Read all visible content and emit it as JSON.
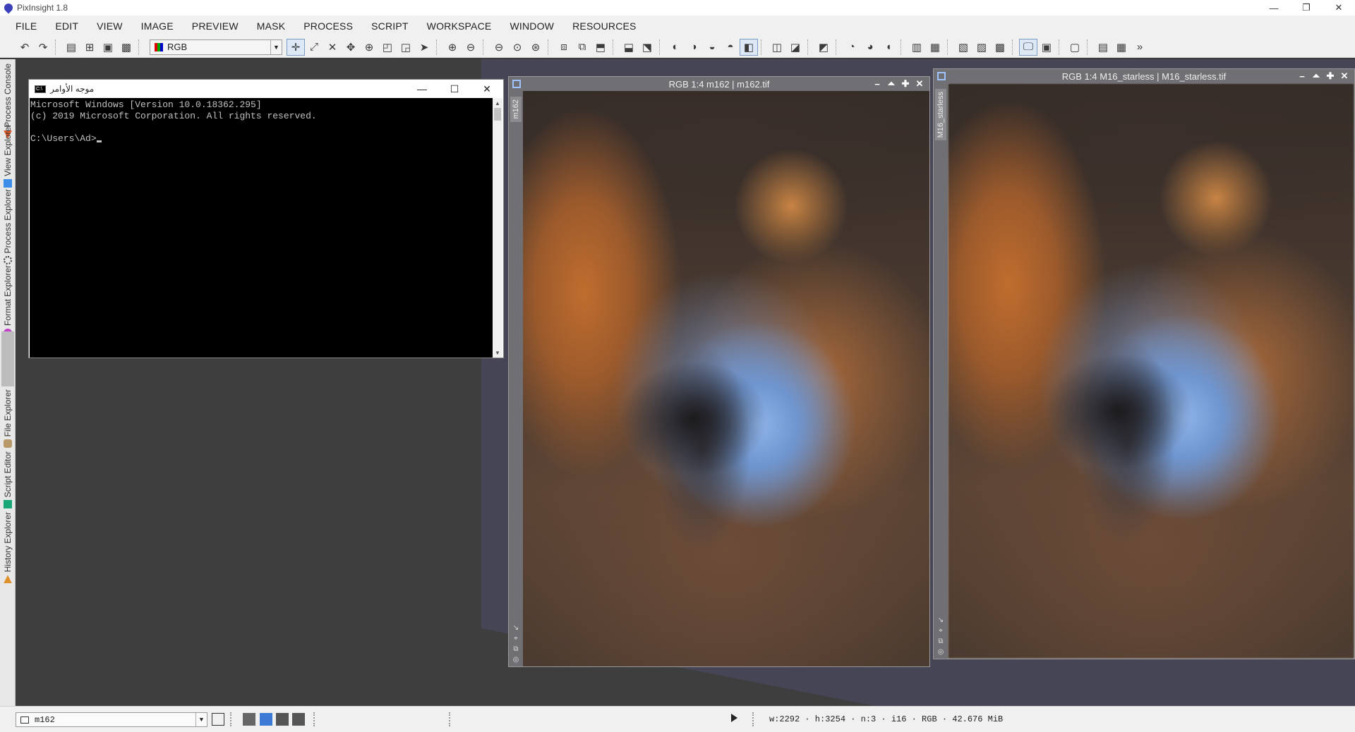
{
  "app": {
    "title": "PixInsight 1.8"
  },
  "window_controls": {
    "minimize": "—",
    "restore": "❐",
    "close": "✕"
  },
  "menu": [
    "FILE",
    "EDIT",
    "VIEW",
    "IMAGE",
    "PREVIEW",
    "MASK",
    "PROCESS",
    "SCRIPT",
    "WORKSPACE",
    "WINDOW",
    "RESOURCES"
  ],
  "toolbar": {
    "color_space": "RGB",
    "overflow": "»"
  },
  "side_panel": {
    "tabs": [
      {
        "label": "Process Console",
        "icon": "process-console-icon",
        "color": "#e0592a"
      },
      {
        "label": "View Explorer",
        "icon": "view-explorer-icon",
        "color": "#3d8ee8"
      },
      {
        "label": "Process Explorer",
        "icon": "gear-icon",
        "color": "#444444"
      },
      {
        "label": "Format Explorer",
        "icon": "format-explorer-icon",
        "color": "#c040c8"
      },
      {
        "label": "File Explorer",
        "icon": "file-explorer-icon",
        "color": "#b89a6a"
      },
      {
        "label": "Script Editor",
        "icon": "script-editor-icon",
        "color": "#18a878"
      },
      {
        "label": "History Explorer",
        "icon": "history-explorer-icon",
        "color": "#e0902a"
      }
    ]
  },
  "cmd_window": {
    "title": "موجه الأوامر",
    "icon_text": "C:\\",
    "lines": [
      "Microsoft Windows [Version 10.0.18362.295]",
      "(c) 2019 Microsoft Corporation. All rights reserved.",
      "",
      "C:\\Users\\Ad>"
    ]
  },
  "image_windows": [
    {
      "title": "RGB 1:4 m162 | m162.tif",
      "tab": "m162"
    },
    {
      "title": "RGB 1:4 M16_starless | M16_starless.tif",
      "tab": "M16_starless"
    }
  ],
  "statusbar": {
    "view": "m162",
    "info": "w:2292 · h:3254 · n:3 · i16 · RGB · 42.676 MiB"
  }
}
